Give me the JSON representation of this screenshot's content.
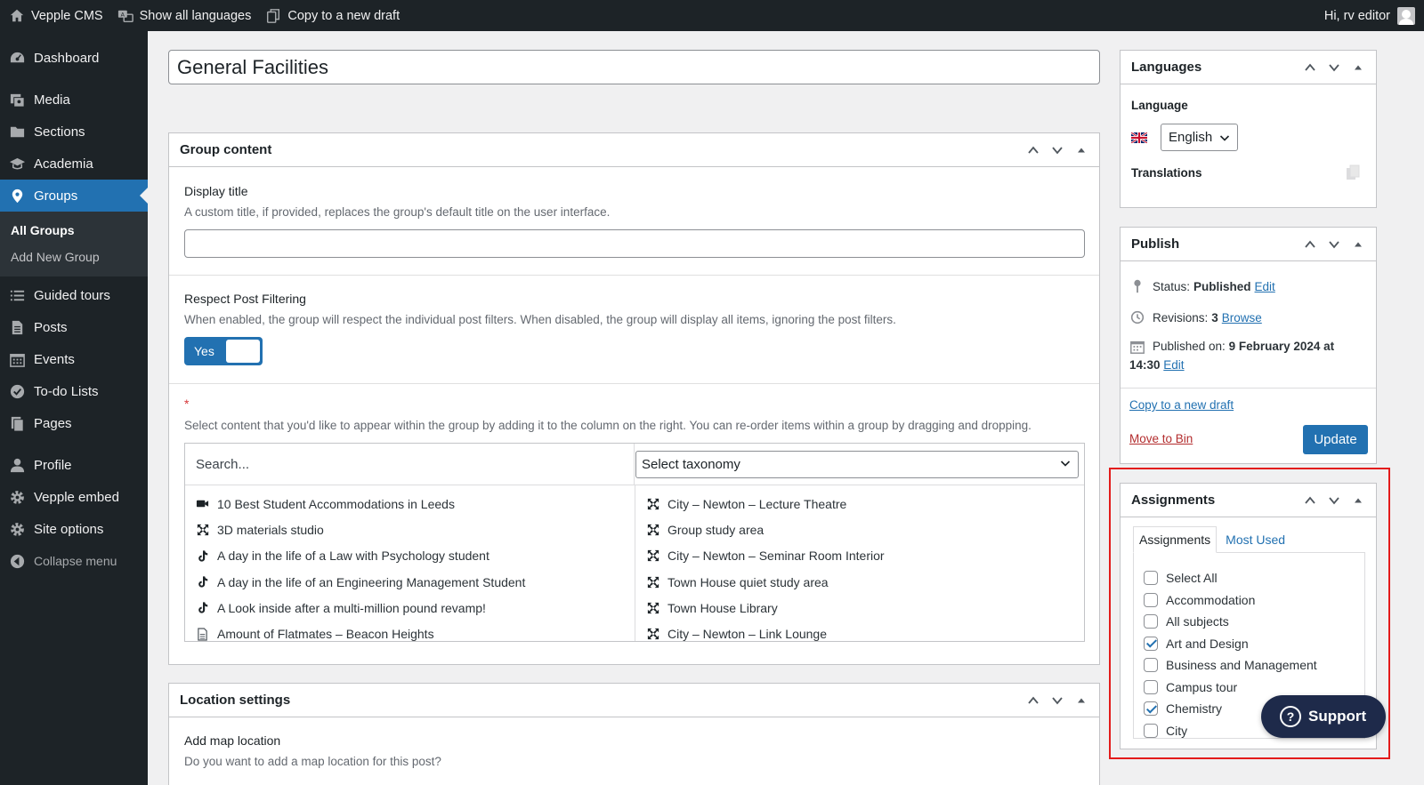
{
  "admin_bar": {
    "site_name": "Vepple CMS",
    "show_languages": "Show all languages",
    "copy_draft": "Copy to a new draft",
    "greeting": "Hi, rv editor"
  },
  "sidebar": {
    "items": [
      {
        "label": "Dashboard",
        "icon": "dashboard-icon"
      },
      {
        "label": "Media",
        "icon": "media-icon"
      },
      {
        "label": "Sections",
        "icon": "folder-icon"
      },
      {
        "label": "Academia",
        "icon": "mortarboard-icon"
      },
      {
        "label": "Groups",
        "icon": "location-pin-icon"
      },
      {
        "label": "Guided tours",
        "icon": "list-icon"
      },
      {
        "label": "Posts",
        "icon": "posts-icon"
      },
      {
        "label": "Events",
        "icon": "calendar-icon"
      },
      {
        "label": "To-do Lists",
        "icon": "check-circle-icon"
      },
      {
        "label": "Pages",
        "icon": "pages-icon"
      },
      {
        "label": "Profile",
        "icon": "user-icon"
      },
      {
        "label": "Vepple embed",
        "icon": "gear-icon"
      },
      {
        "label": "Site options",
        "icon": "gear-icon"
      },
      {
        "label": "Collapse menu",
        "icon": "collapse-icon"
      }
    ],
    "submenu": {
      "all_groups": "All Groups",
      "add_new": "Add New Group"
    }
  },
  "post": {
    "title": "General Facilities"
  },
  "group_content": {
    "heading": "Group content",
    "display_title_label": "Display title",
    "display_title_desc": "A custom title, if provided, replaces the group's default title on the user interface.",
    "respect_label": "Respect Post Filtering",
    "respect_desc": "When enabled, the group will respect the individual post filters. When disabled, the group will display all items, ignoring the post filters.",
    "toggle_label": "Yes",
    "required_mark": "*",
    "select_desc": "Select content that you'd like to appear within the group by adding it to the column on the right. You can re-order items within a group by dragging and dropping.",
    "search_placeholder": "Search...",
    "taxonomy_select": "Select taxonomy",
    "available": [
      {
        "label": "10 Best Student Accommodations in Leeds",
        "icon": "video-icon"
      },
      {
        "label": "3D materials studio",
        "icon": "panorama-icon"
      },
      {
        "label": "A day in the life of a Law with Psychology student",
        "icon": "tiktok-icon"
      },
      {
        "label": "A day in the life of an Engineering Management Student",
        "icon": "tiktok-icon"
      },
      {
        "label": "A Look inside after a multi-million pound revamp!",
        "icon": "tiktok-icon"
      },
      {
        "label": "Amount of Flatmates – Beacon Heights",
        "icon": "document-icon"
      }
    ],
    "selected": [
      {
        "label": "City – Newton – Lecture Theatre",
        "icon": "panorama-icon"
      },
      {
        "label": "Group study area",
        "icon": "panorama-icon"
      },
      {
        "label": "City – Newton – Seminar Room Interior",
        "icon": "panorama-icon"
      },
      {
        "label": "Town House quiet study area",
        "icon": "panorama-icon"
      },
      {
        "label": "Town House Library",
        "icon": "panorama-icon"
      },
      {
        "label": "City – Newton – Link Lounge",
        "icon": "panorama-icon"
      }
    ]
  },
  "location": {
    "heading": "Location settings",
    "add_map_label": "Add map location",
    "add_map_desc": "Do you want to add a map location for this post?"
  },
  "languages": {
    "heading": "Languages",
    "language_label": "Language",
    "selected": "English",
    "translations_label": "Translations"
  },
  "publish": {
    "heading": "Publish",
    "status_label": "Status:",
    "status_value": "Published",
    "edit": "Edit",
    "revisions_label": "Revisions:",
    "revisions_value": "3",
    "browse": "Browse",
    "published_label": "Published on:",
    "published_value_1": "9 February 2024 at",
    "published_value_2": "14:30",
    "copy_draft": "Copy to a new draft",
    "move_to_bin": "Move to Bin",
    "update": "Update"
  },
  "assignments": {
    "heading": "Assignments",
    "tab_all": "Assignments",
    "tab_most_used": "Most Used",
    "items": [
      {
        "label": "Select All",
        "checked": false
      },
      {
        "label": "Accommodation",
        "checked": false
      },
      {
        "label": "All subjects",
        "checked": false
      },
      {
        "label": "Art and Design",
        "checked": true
      },
      {
        "label": "Business and Management",
        "checked": false
      },
      {
        "label": "Campus tour",
        "checked": false
      },
      {
        "label": "Chemistry",
        "checked": true
      },
      {
        "label": "City",
        "checked": false
      }
    ]
  },
  "support": {
    "label": "Support"
  },
  "colors": {
    "accent": "#2271b1",
    "sidebar": "#1d2327",
    "highlight": "#e31b1b",
    "support": "#1e2a4a"
  }
}
